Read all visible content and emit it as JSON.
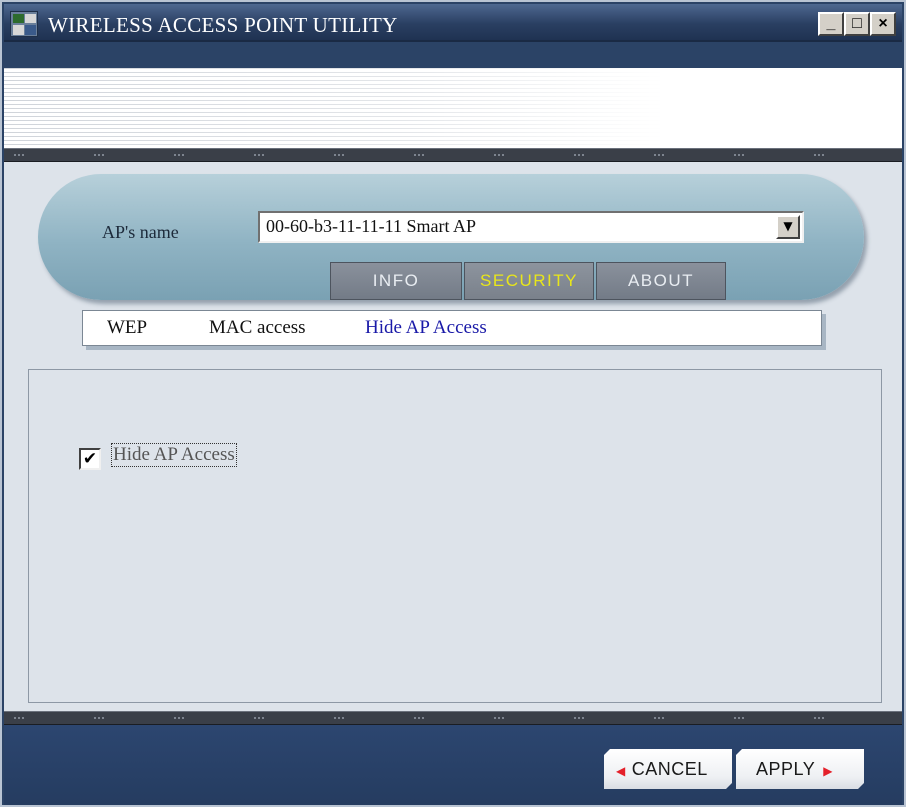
{
  "window": {
    "title": "WIRELESS ACCESS POINT UTILITY",
    "controls": {
      "minimize": "_",
      "maximize": "□",
      "close": "×"
    }
  },
  "ap_selector": {
    "label": "AP's name",
    "selected": "00-60-b3-11-11-11 Smart AP",
    "dropdown_icon": "▼"
  },
  "tabs": [
    {
      "label": "INFO",
      "active": false
    },
    {
      "label": "SECURITY",
      "active": true
    },
    {
      "label": "ABOUT",
      "active": false
    }
  ],
  "subtabs": [
    {
      "label": "WEP",
      "active": false
    },
    {
      "label": "MAC access",
      "active": false
    },
    {
      "label": "Hide AP Access",
      "active": true
    }
  ],
  "content": {
    "checkbox_label": "Hide AP Access",
    "checkbox_checked": true,
    "check_glyph": "✔"
  },
  "footer": {
    "cancel_label": "CANCEL",
    "apply_label": "APPLY",
    "cancel_arrow": "◀",
    "apply_arrow": "▶"
  },
  "colors": {
    "active_tab_text": "#e8e61a",
    "active_subtab_text": "#1a1aa8",
    "button_arrow": "#e4202a",
    "title_bar": "#2a3f62"
  }
}
